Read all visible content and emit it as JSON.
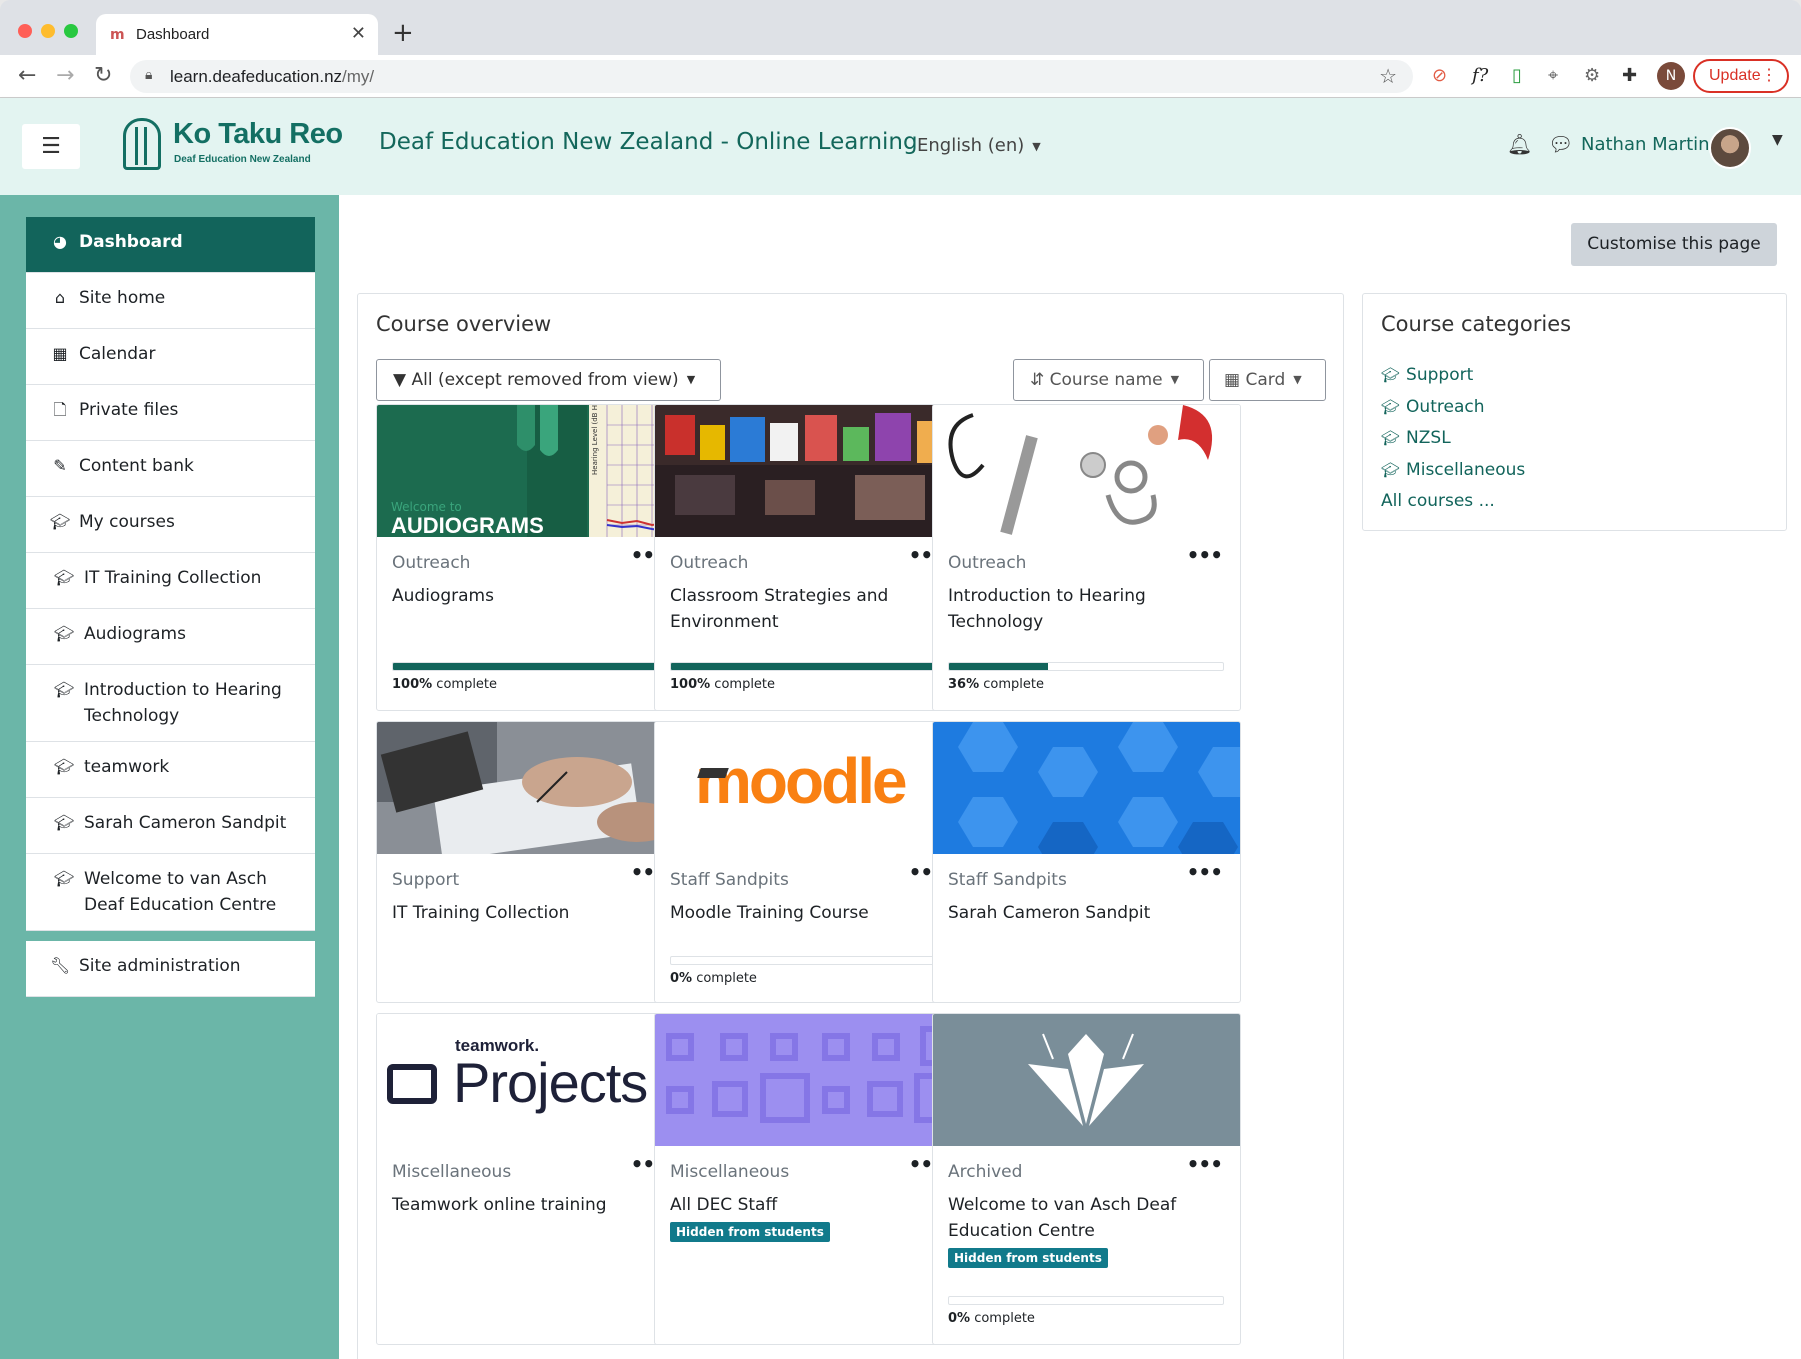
{
  "browser": {
    "tab_title": "Dashboard",
    "tab_favicon": "m",
    "url_host": "learn.deafeducation.nz",
    "url_path": "/my/",
    "profile_initial": "N",
    "update_label": "Update"
  },
  "navbar": {
    "logo_text": "Ko Taku Reo",
    "logo_sub": "Deaf Education New Zealand",
    "site_title": "Deaf Education New Zealand - Online Learning",
    "language": "English (en)",
    "user_name": "Nathan Martin"
  },
  "drawer": {
    "items": [
      {
        "label": "Dashboard",
        "icon": "dashboard-icon"
      },
      {
        "label": "Site home",
        "icon": "home-icon"
      },
      {
        "label": "Calendar",
        "icon": "calendar-icon"
      },
      {
        "label": "Private files",
        "icon": "file-icon"
      },
      {
        "label": "Content bank",
        "icon": "brush-icon"
      },
      {
        "label": "My courses",
        "icon": "graduation-cap-icon"
      },
      {
        "label": "IT Training Collection",
        "icon": "graduation-cap-icon"
      },
      {
        "label": "Audiograms",
        "icon": "graduation-cap-icon"
      },
      {
        "label": "Introduction to Hearing Technology",
        "icon": "graduation-cap-icon"
      },
      {
        "label": "teamwork",
        "icon": "graduation-cap-icon"
      },
      {
        "label": "Sarah Cameron Sandpit",
        "icon": "graduation-cap-icon"
      },
      {
        "label": "Welcome to van Asch Deaf Education Centre",
        "icon": "graduation-cap-icon"
      }
    ],
    "admin_label": "Site administration"
  },
  "main": {
    "customise_label": "Customise this page",
    "overview": {
      "title": "Course overview",
      "filter_label": "All (except removed from view)",
      "sort_label": "Course name",
      "view_label": "Card",
      "courses": [
        {
          "category": "Outreach",
          "name": "Audiograms",
          "progress": 100,
          "progress_label": "100%",
          "complete_word": " complete",
          "image_caption": "Welcome to",
          "image_title": "AUDIOGRAMS"
        },
        {
          "category": "Outreach",
          "name": "Classroom Strategies and Environment",
          "progress": 100,
          "progress_label": "100%",
          "complete_word": " complete"
        },
        {
          "category": "Outreach",
          "name": "Introduction to Hearing Technology",
          "progress": 36,
          "progress_label": "36%",
          "complete_word": " complete"
        },
        {
          "category": "Support",
          "name": "IT Training Collection"
        },
        {
          "category": "Staff Sandpits",
          "name": "Moodle Training Course",
          "progress": 0,
          "progress_label": "0%",
          "complete_word": " complete",
          "image_logo": "moodle"
        },
        {
          "category": "Staff Sandpits",
          "name": "Sarah Cameron Sandpit"
        },
        {
          "category": "Miscellaneous",
          "name": "Teamwork online training",
          "image_brand": "teamwork.",
          "image_product": "Projects"
        },
        {
          "category": "Miscellaneous",
          "name": "All DEC Staff",
          "badge": "Hidden from students"
        },
        {
          "category": "Archived",
          "name": "Welcome to van Asch Deaf Education Centre",
          "badge": "Hidden from students",
          "progress": 0,
          "progress_label": "0%",
          "complete_word": " complete"
        }
      ]
    },
    "categories": {
      "title": "Course categories",
      "items": [
        "Support",
        "Outreach",
        "NZSL",
        "Miscellaneous"
      ],
      "all_label": "All courses ..."
    }
  },
  "colors": {
    "brand_dark": "#12645b",
    "drawer_bg": "#6bb6a8",
    "navbar_bg": "#e3f4f1",
    "badge_bg": "#117a8b"
  }
}
